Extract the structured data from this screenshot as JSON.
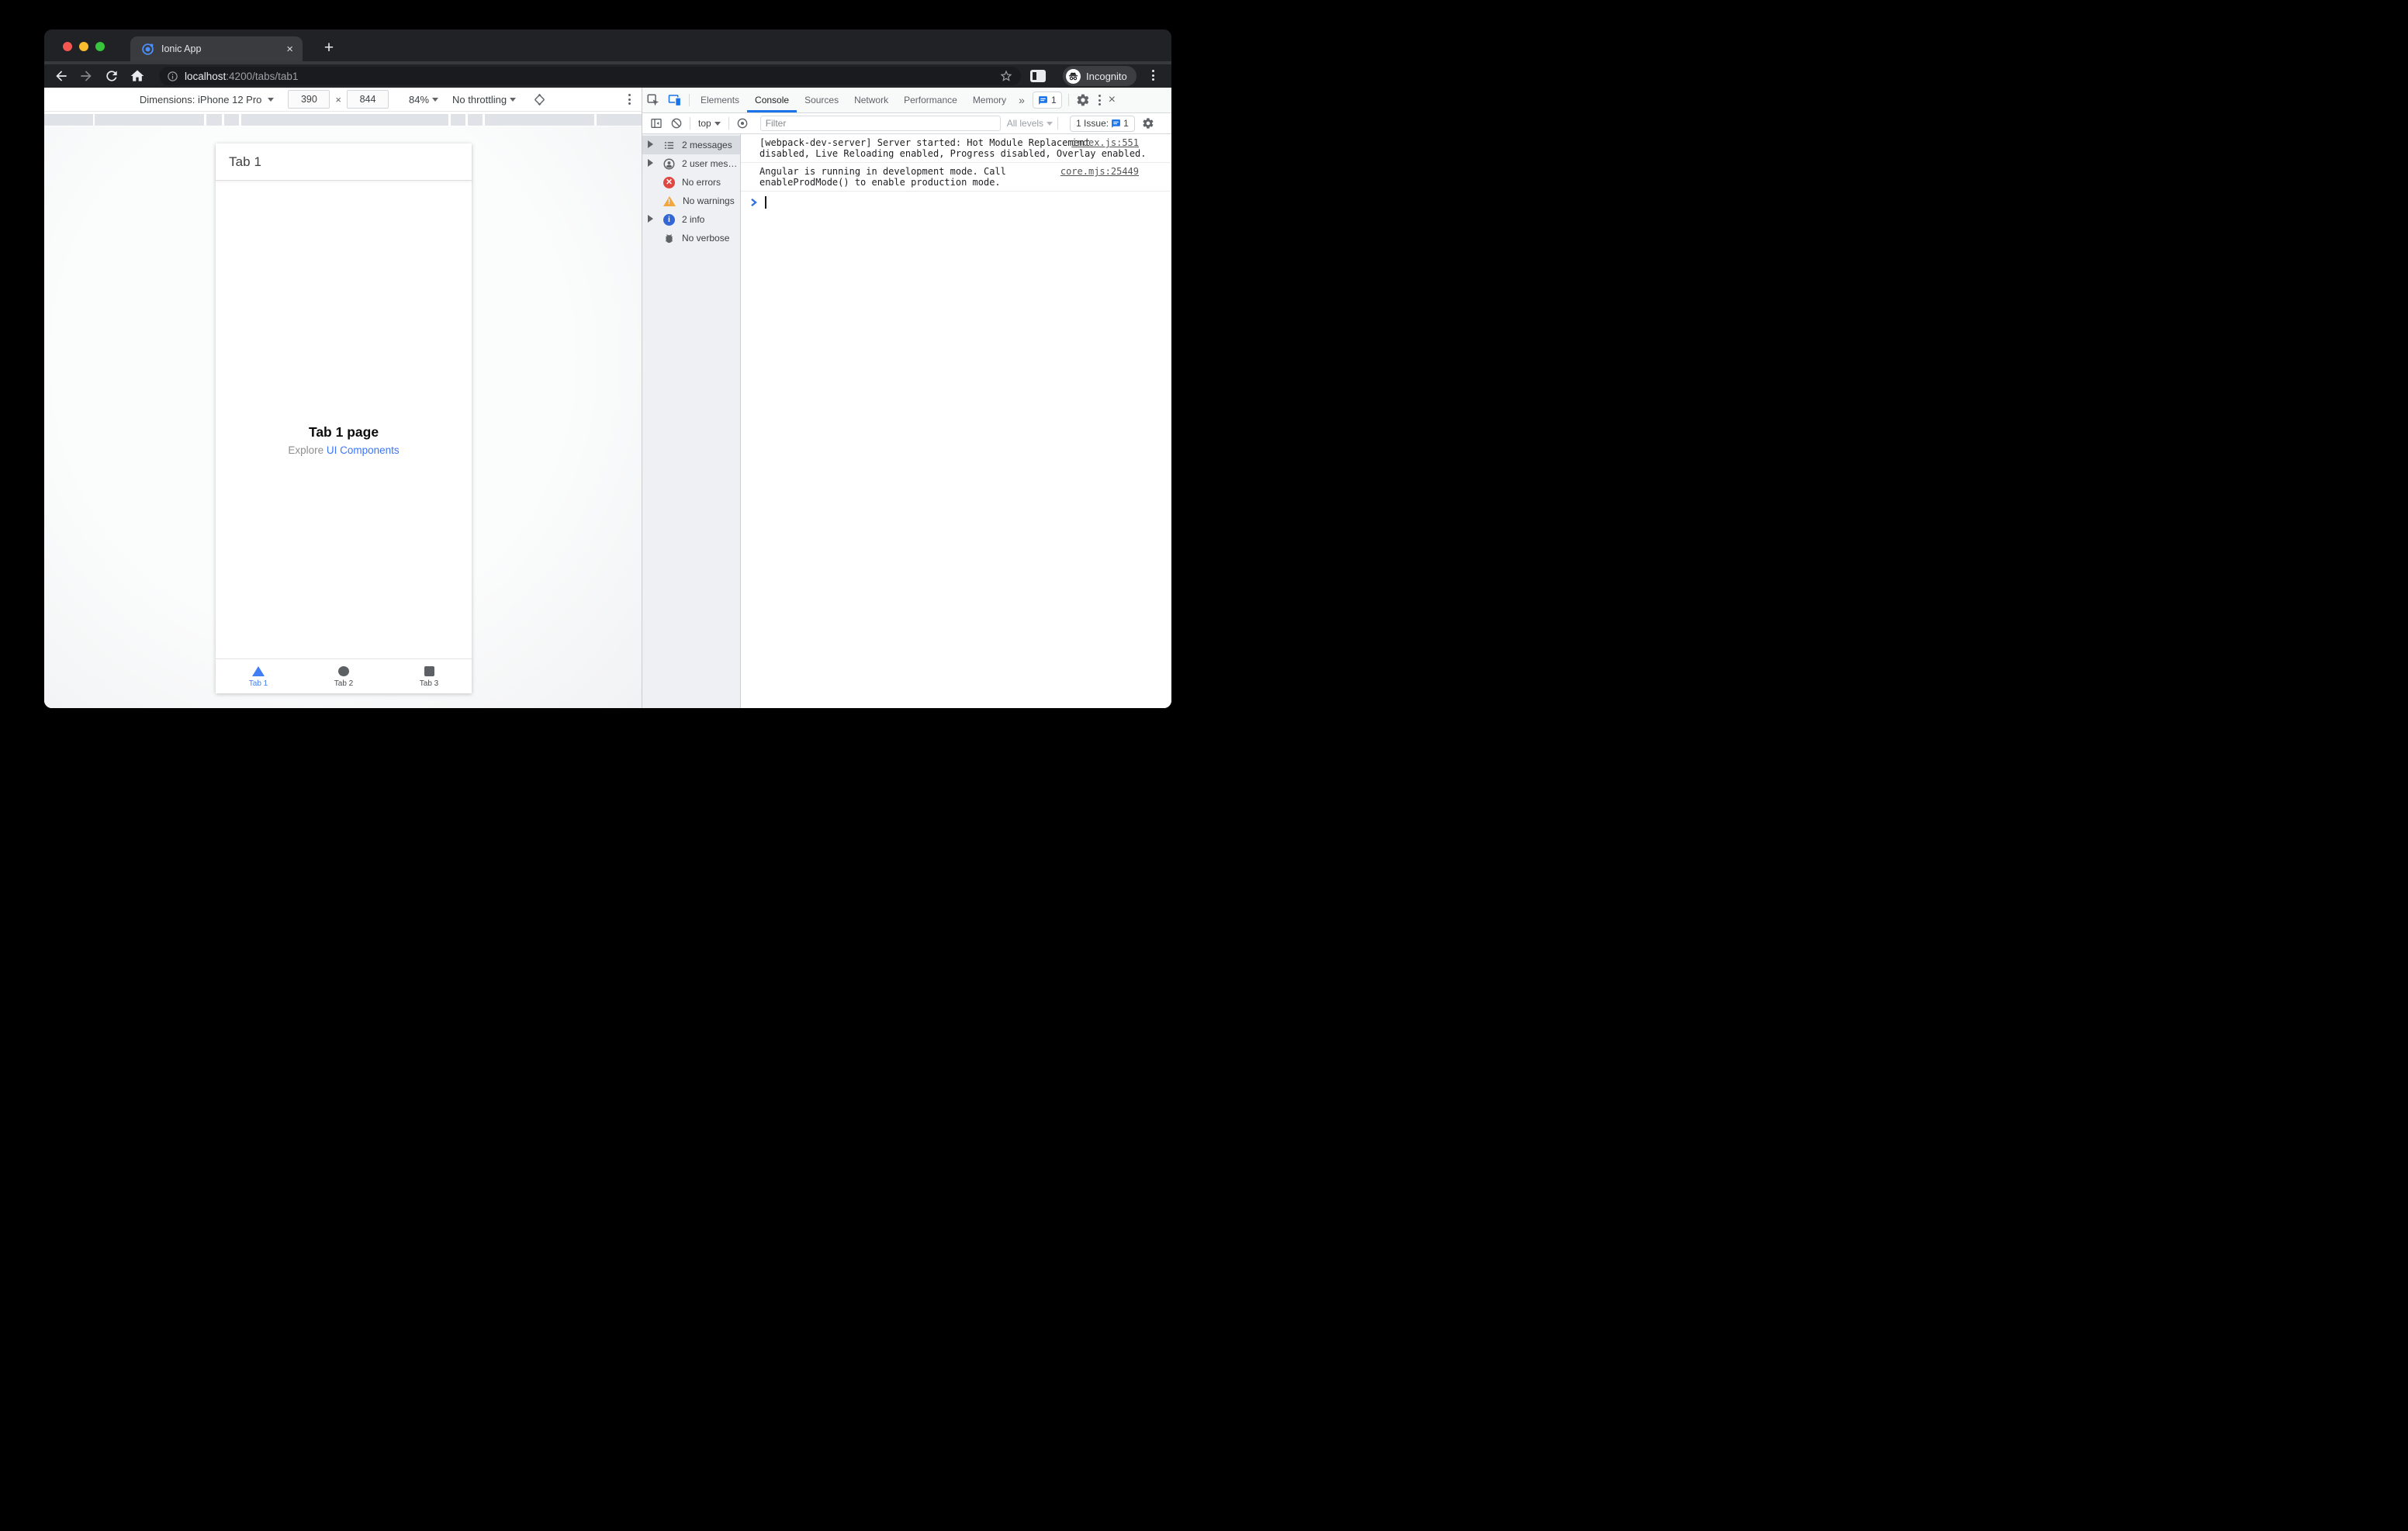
{
  "window": {
    "tab_title": "Ionic App",
    "new_tab_symbol": "+",
    "close_symbol": "×"
  },
  "url": {
    "host": "localhost",
    "rest": ":4200/tabs/tab1"
  },
  "incognito_label": "Incognito",
  "device_toolbar": {
    "dimensions_label": "Dimensions: iPhone 12 Pro",
    "width_value": "390",
    "times_symbol": "×",
    "height_value": "844",
    "zoom_value": "84%",
    "throttling_value": "No throttling"
  },
  "app": {
    "header_title": "Tab 1",
    "page_title": "Tab 1 page",
    "explore_text": "Explore ",
    "link_text": "UI Components",
    "tabs": [
      {
        "label": "Tab 1",
        "active": true
      },
      {
        "label": "Tab 2",
        "active": false
      },
      {
        "label": "Tab 3",
        "active": false
      }
    ],
    "accent": "#427ef3",
    "link_color": "#3b76f6"
  },
  "devtools": {
    "tabs": [
      "Elements",
      "Console",
      "Sources",
      "Network",
      "Performance",
      "Memory"
    ],
    "active_tab": "Console",
    "more_symbol": "»",
    "issues_tab_count": "1",
    "close_symbol": "×",
    "console_toolbar": {
      "context": "top",
      "filter_placeholder": "Filter",
      "levels": "All levels",
      "issues_label": "1 Issue:",
      "issues_count": "1"
    },
    "sidebar": {
      "items": [
        {
          "label": "2 messages",
          "selected": true
        },
        {
          "label": "2 user mes…",
          "selected": false
        },
        {
          "label": "No errors",
          "selected": false
        },
        {
          "label": "No warnings",
          "selected": false
        },
        {
          "label": "2 info",
          "selected": false
        },
        {
          "label": "No verbose",
          "selected": false
        }
      ]
    },
    "messages": [
      {
        "lines": [
          "[webpack-dev-server] Server started: Hot Module Replacement",
          "disabled, Live Reloading enabled, Progress disabled, Overlay enabled."
        ],
        "source": "index.js:551"
      },
      {
        "lines": [
          "Angular is running in development mode. Call",
          "enableProdMode() to enable production mode."
        ],
        "source": "core.mjs:25449"
      }
    ]
  },
  "colors": {
    "devtools_accent": "#1a73e8",
    "error_red": "#df4740",
    "warning_yellow": "#f1a73d",
    "info_blue": "#3367d6",
    "traffic_red": "#f45750",
    "traffic_yellow": "#f9bd2e",
    "traffic_green": "#38c53e"
  }
}
